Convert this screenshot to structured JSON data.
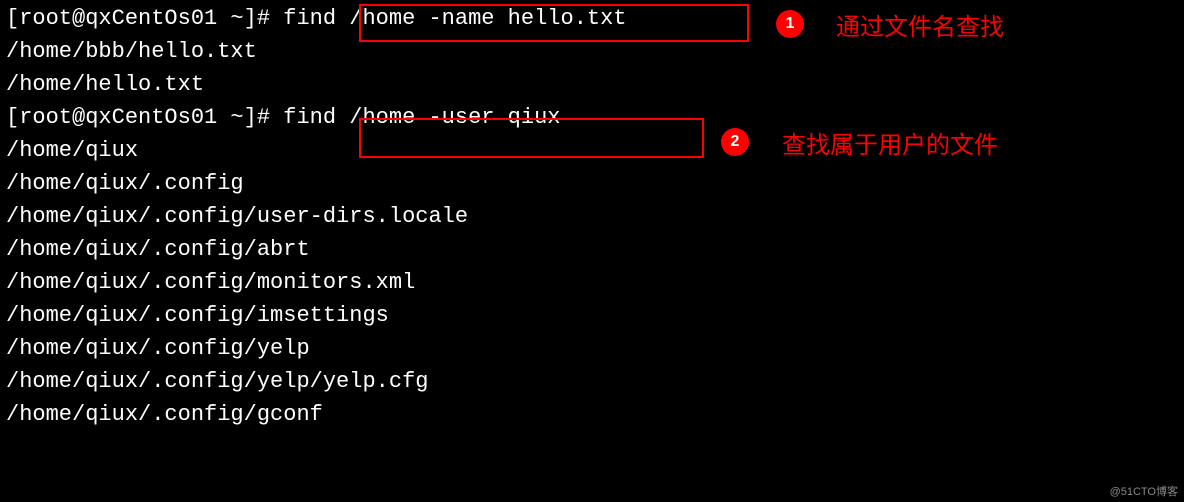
{
  "prompt": "[root@qxCentOs01 ~]#",
  "commands": {
    "cmd1": "find /home -name hello.txt",
    "cmd2": "find /home -user qiux"
  },
  "output": {
    "line1": "/home/bbb/hello.txt",
    "line2": "/home/hello.txt",
    "line3": "/home/qiux",
    "line4": "/home/qiux/.config",
    "line5": "/home/qiux/.config/user-dirs.locale",
    "line6": "/home/qiux/.config/abrt",
    "line7": "/home/qiux/.config/monitors.xml",
    "line8": "/home/qiux/.config/imsettings",
    "line9": "/home/qiux/.config/yelp",
    "line10": "/home/qiux/.config/yelp/yelp.cfg",
    "line11": "/home/qiux/.config/gconf"
  },
  "badges": {
    "b1": "1",
    "b2": "2"
  },
  "annotations": {
    "a1": "通过文件名查找",
    "a2": "查找属于用户的文件"
  },
  "watermark": "@51CTO博客"
}
